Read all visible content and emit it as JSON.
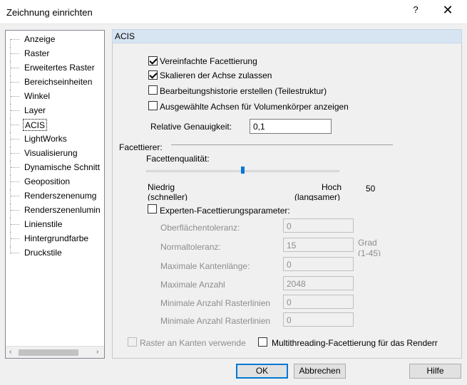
{
  "window": {
    "title": "Zeichnung einrichten",
    "help_glyph": "?",
    "close_glyph": "✕"
  },
  "tree": {
    "items": [
      {
        "label": "Anzeige"
      },
      {
        "label": "Raster"
      },
      {
        "label": "Erweitertes Raster"
      },
      {
        "label": "Bereichseinheiten"
      },
      {
        "label": "Winkel"
      },
      {
        "label": "Layer"
      },
      {
        "label": "ACIS"
      },
      {
        "label": "LightWorks"
      },
      {
        "label": "Visualisierung"
      },
      {
        "label": "Dynamische Schnitt"
      },
      {
        "label": "Geoposition"
      },
      {
        "label": "Renderszenenumg"
      },
      {
        "label": "Renderszenenlumin"
      },
      {
        "label": "Linienstile"
      },
      {
        "label": "Hintergrundfarbe"
      },
      {
        "label": "Druckstile"
      }
    ],
    "selected": "ACIS",
    "scroll_left": "‹",
    "scroll_right": "›"
  },
  "panel": {
    "header": "ACIS",
    "options": {
      "vereinfachte": "Vereinfachte Facettierung",
      "skalieren": "Skalieren der Achse zulassen",
      "bearbeitungshistorie": "Bearbeitungshistorie erstellen (Teilestruktur)",
      "ausgewaehlte": "Ausgewählte Achsen für Volumenkörper anzeigen"
    },
    "relative_label": "Relative Genauigkeit:",
    "relative_value": "0,1",
    "facettierer_label": "Facettierer:",
    "quality_label": "Facettenqualität:",
    "quality_value": 50,
    "quality_value_text": "50",
    "low_label": "Niedrig",
    "low_sub": "(schneller)",
    "high_label": "Hoch",
    "high_sub": "(langsamer)",
    "expert_label": "Experten-Facettierungsparameter:",
    "fields": {
      "oberflaeche_label": "Oberflächentoleranz:",
      "oberflaeche_value": "0",
      "normal_label": "Normaltoleranz:",
      "normal_value": "15",
      "normal_unit": "Grad",
      "normal_range": "(1-45)",
      "kanten_label": "Maximale Kantenlänge:",
      "kanten_value": "0",
      "anzahl_label": "Maximale Anzahl",
      "anzahl_value": "2048",
      "raster1_label": "Minimale Anzahl Rasterlinien",
      "raster1_value": "0",
      "raster2_label": "Minimale Anzahl Rasterlinien",
      "raster2_value": "0"
    },
    "raster_kanten": "Raster an Kanten verwende",
    "multithreading": "Multithreading-Facettierung für das Renderr"
  },
  "buttons": {
    "ok": "OK",
    "cancel": "Abbrechen",
    "help": "Hilfe"
  },
  "colors": {
    "accent": "#0078d7",
    "panel_header": "#d7e4f2"
  }
}
